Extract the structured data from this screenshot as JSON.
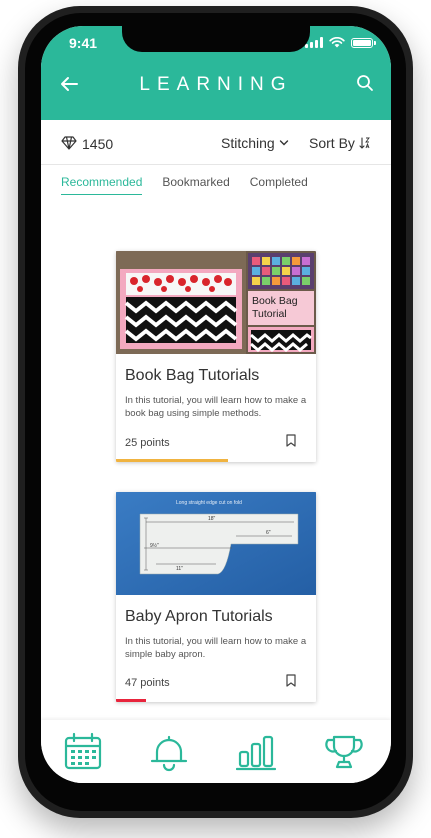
{
  "status": {
    "time": "9:41"
  },
  "header": {
    "title": "LEARNING"
  },
  "filters": {
    "points_total": "1450",
    "category": "Stitching",
    "sort_label": "Sort By"
  },
  "tabs": [
    "Recommended",
    "Bookmarked",
    "Completed"
  ],
  "cards": [
    {
      "title": "Book Bag Tutorials",
      "description": "In this tutorial, you will learn how to make a book bag using simple methods.",
      "points": "25 points",
      "image_caption": "Book Bag\nTutorial",
      "progress": 0.56,
      "progress_color": "#f0b340"
    },
    {
      "title": "Baby Apron Tutorials",
      "description": "In this tutorial, you will learn how to make a simple baby apron.",
      "points": "47 points",
      "image_caption": "Long straight edge cut on fold",
      "progress": 0.15,
      "progress_color": "#e8243c"
    }
  ],
  "bottom_nav": [
    "calendar-icon",
    "bell-icon",
    "stats-icon",
    "trophy-icon"
  ],
  "colors": {
    "accent": "#2bb89a"
  }
}
